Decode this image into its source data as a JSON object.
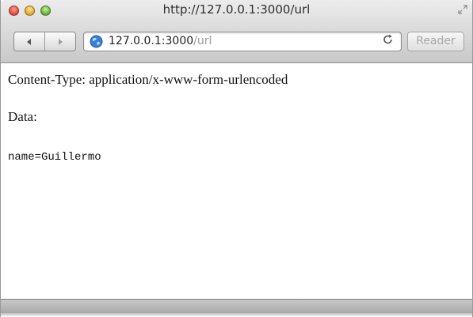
{
  "window": {
    "title": "http://127.0.0.1:3000/url"
  },
  "toolbar": {
    "back_icon": "back-arrow-icon",
    "forward_icon": "forward-arrow-icon",
    "address": {
      "host": "127.0.0.1:3000",
      "path": "/url"
    },
    "reload_icon": "reload-icon",
    "reader_label": "Reader"
  },
  "page": {
    "content_type_line": "Content-Type: application/x-www-form-urlencoded",
    "data_label": "Data:",
    "data_value": "name=Guillermo"
  },
  "colors": {
    "close": "#e2463a",
    "minimize": "#e1a429",
    "maximize": "#5fae32",
    "globe": "#3a7fd6"
  }
}
